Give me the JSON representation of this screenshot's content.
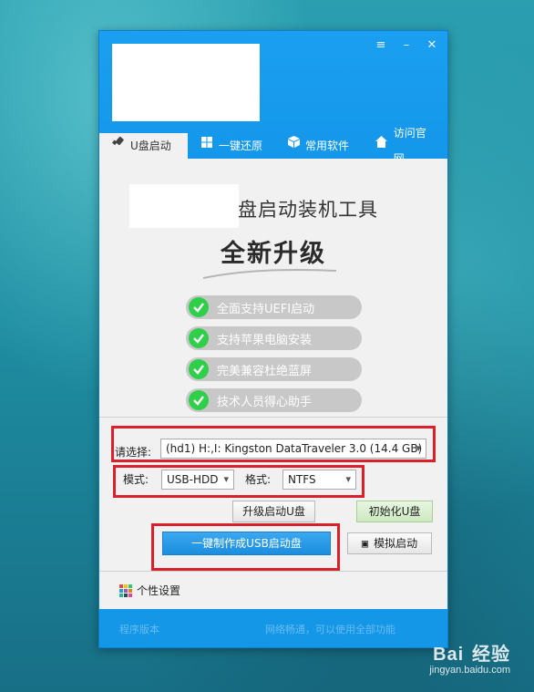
{
  "window": {
    "buttons": {
      "settings": "≡",
      "minimize": "–",
      "close": "✕"
    }
  },
  "tabs": [
    {
      "label": "U盘启动",
      "icon": "usb-icon"
    },
    {
      "label": "一键还原",
      "icon": "windows-icon"
    },
    {
      "label": "常用软件",
      "icon": "box-icon"
    },
    {
      "label": "访问官网",
      "icon": "home-icon"
    }
  ],
  "hero": {
    "title": "盘启动装机工具",
    "subtitle": "全新升级"
  },
  "features": [
    "全面支持UEFI启动",
    "支持苹果电脑安装",
    "完美兼容杜绝蓝屏",
    "技术人员得心助手"
  ],
  "form": {
    "device_label": "请选择:",
    "device_value": "(hd1) H:,I: Kingston DataTraveler 3.0 (14.4 GB)",
    "mode_label": "模式:",
    "mode_value": "USB-HDD",
    "format_label": "格式:",
    "format_value": "NTFS"
  },
  "buttons": {
    "upgrade": "升级启动U盘",
    "initialize": "初始化U盘",
    "make": "一键制作成USB启动盘",
    "simulate": "模拟启动"
  },
  "settings_label": "个性设置",
  "status": {
    "left": "程序版本",
    "right": "网络畅通，可以使用全部功能"
  },
  "watermark": {
    "logo": "Bai",
    "logo_suffix": "经验",
    "url": "jingyan.baidu.com"
  },
  "colors": {
    "titlebar": "#1b9ff0",
    "check": "#2fcf4a",
    "highlight": "#d9202b",
    "primary_button": "#1b8ee0"
  }
}
